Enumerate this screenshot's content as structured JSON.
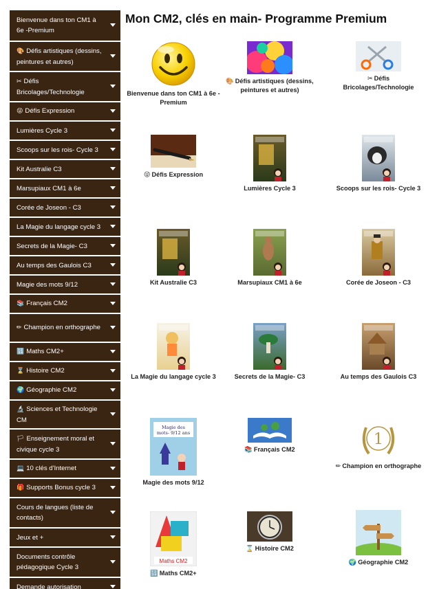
{
  "page_title": "Mon CM2, clés en main- Programme Premium",
  "sidebar": {
    "items": [
      {
        "label": "Bienvenue dans ton CM1 à 6e -Premium",
        "emoji": ""
      },
      {
        "label": "Défis artistiques (dessins, peintures et autres)",
        "emoji": "🎨"
      },
      {
        "label": "Défis Bricolages/Technologie",
        "emoji": "✂"
      },
      {
        "label": "Défis Expression",
        "emoji": "😜"
      },
      {
        "label": "Lumières Cycle 3",
        "emoji": ""
      },
      {
        "label": "Scoops sur les rois- Cycle 3",
        "emoji": ""
      },
      {
        "label": "Kit Australie C3",
        "emoji": ""
      },
      {
        "label": "Marsupiaux CM1 à 6e",
        "emoji": ""
      },
      {
        "label": "Corée de Joseon - C3",
        "emoji": ""
      },
      {
        "label": "La Magie du langage cycle 3",
        "emoji": ""
      },
      {
        "label": "Secrets de la Magie- C3",
        "emoji": ""
      },
      {
        "label": "Au temps des Gaulois C3",
        "emoji": ""
      },
      {
        "label": "Magie des mots 9/12",
        "emoji": ""
      },
      {
        "label": "Français CM2",
        "emoji": "📚"
      },
      {
        "label": "Champion en orthographe",
        "emoji": "✏"
      },
      {
        "label": "Maths CM2+",
        "emoji": "🔢"
      },
      {
        "label": "Histoire CM2",
        "emoji": "⌛"
      },
      {
        "label": "Géographie CM2",
        "emoji": "🌍"
      },
      {
        "label": "Sciences et Technologie CM",
        "emoji": "🔬"
      },
      {
        "label": "Enseignement moral et civique cycle 3",
        "emoji": "🏳"
      },
      {
        "label": "10 clés d'Internet",
        "emoji": "💻"
      },
      {
        "label": "Supports Bonus cycle 3",
        "emoji": "🎁"
      },
      {
        "label": "Cours de langues (liste de contacts)",
        "emoji": ""
      },
      {
        "label": "Jeux et +",
        "emoji": ""
      },
      {
        "label": "Documents contrôle pédagogique Cycle 3",
        "emoji": ""
      },
      {
        "label": "Demande autorisation",
        "emoji": ""
      }
    ]
  },
  "cards": [
    {
      "label": "Bienvenue dans ton CM1 à 6e -Premium",
      "emoji": "",
      "thumb": "smiley-icon"
    },
    {
      "label": "Défis artistiques (dessins, peintures et autres)",
      "emoji": "🎨",
      "thumb": "paint-splash"
    },
    {
      "label": "Défis Bricolages/Technologie",
      "emoji": "✂",
      "thumb": "scissors"
    },
    {
      "label": "Défis Expression",
      "emoji": "😜",
      "thumb": "fountain-pen"
    },
    {
      "label": "Lumières Cycle 3",
      "emoji": "",
      "thumb": "book-cover"
    },
    {
      "label": "Scoops sur les rois- Cycle 3",
      "emoji": "",
      "thumb": "dog-cover"
    },
    {
      "label": "Kit Australie C3",
      "emoji": "",
      "thumb": "book-cover"
    },
    {
      "label": "Marsupiaux CM1 à 6e",
      "emoji": "",
      "thumb": "kangaroo-cover"
    },
    {
      "label": "Corée de Joseon - C3",
      "emoji": "",
      "thumb": "king-cover"
    },
    {
      "label": "La Magie du langage cycle 3",
      "emoji": "",
      "thumb": "girl-cover"
    },
    {
      "label": "Secrets de la Magie- C3",
      "emoji": "",
      "thumb": "mushroom-cover"
    },
    {
      "label": "Au temps des Gaulois C3",
      "emoji": "",
      "thumb": "village-cover"
    },
    {
      "label": "Magie des mots 9/12",
      "emoji": "",
      "thumb": "magie-mots-cover",
      "thumb_title": "Magie des mots- 9/12 ans"
    },
    {
      "label": "Français CM2",
      "emoji": "📚",
      "thumb": "open-book"
    },
    {
      "label": "Champion en orthographe",
      "emoji": "✏",
      "thumb": "laurel-medal",
      "thumb_number": "1"
    },
    {
      "label": "Maths CM2+",
      "emoji": "🔢",
      "thumb": "maths-cover",
      "thumb_title": "Maths CM2"
    },
    {
      "label": "Histoire CM2",
      "emoji": "⌛",
      "thumb": "pocket-watch"
    },
    {
      "label": "Géographie CM2",
      "emoji": "🌍",
      "thumb": "signpost"
    }
  ]
}
